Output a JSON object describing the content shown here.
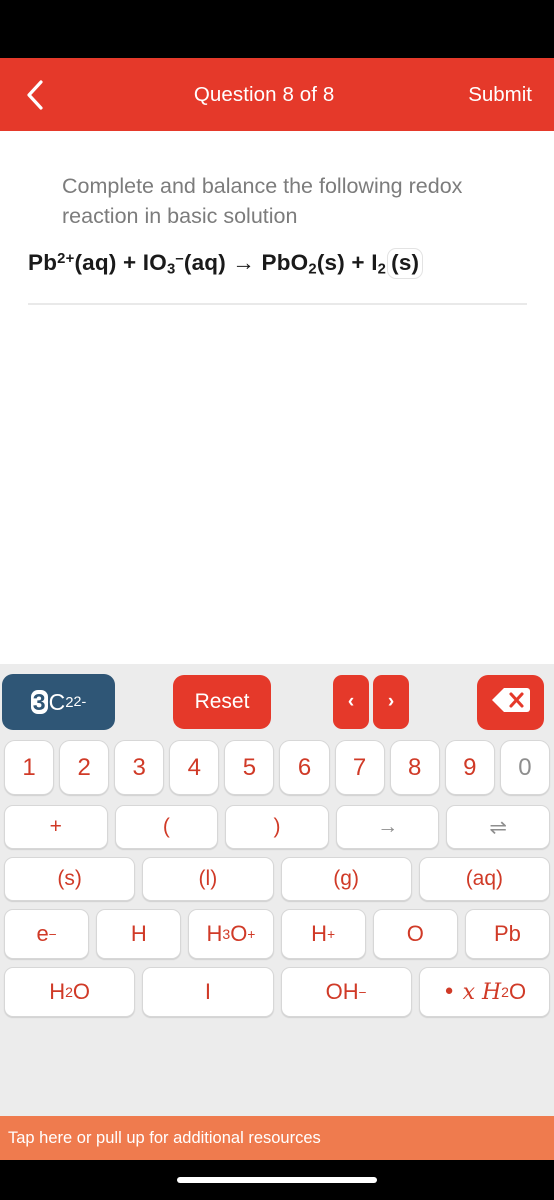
{
  "header": {
    "back_icon": "chevron-left-icon",
    "title": "Question 8 of 8",
    "submit_label": "Submit",
    "background_color": "#e5392a"
  },
  "question": {
    "prompt": "Complete and balance the following redox reaction in basic solution",
    "equation": {
      "parts": [
        {
          "text": "Pb",
          "type": "base"
        },
        {
          "text": "2+",
          "type": "sup"
        },
        {
          "text": "(aq) + IO",
          "type": "base"
        },
        {
          "text": "3",
          "type": "sub"
        },
        {
          "text": "−",
          "type": "sup"
        },
        {
          "text": "(aq) → PbO",
          "type": "base"
        },
        {
          "text": "2",
          "type": "sub"
        },
        {
          "text": "(s) + I",
          "type": "base"
        },
        {
          "text": "2",
          "type": "sub"
        },
        {
          "text": "(s)",
          "type": "cursor"
        }
      ],
      "plain": "Pb2+(aq) + IO3−(aq) → PbO2(s) + I2(s)",
      "cursor_token": "(s)"
    }
  },
  "keypad": {
    "token_chip": {
      "coefficient": "3",
      "symbol": "C",
      "subscript": "2",
      "superscript": "2-",
      "background_color": "#2f5676"
    },
    "reset_label": "Reset",
    "prev_label": "‹",
    "next_label": "›",
    "delete_icon": "backspace-icon",
    "digits": [
      {
        "label": "1",
        "disabled": false
      },
      {
        "label": "2",
        "disabled": false
      },
      {
        "label": "3",
        "disabled": false
      },
      {
        "label": "4",
        "disabled": false
      },
      {
        "label": "5",
        "disabled": false
      },
      {
        "label": "6",
        "disabled": false
      },
      {
        "label": "7",
        "disabled": false
      },
      {
        "label": "8",
        "disabled": false
      },
      {
        "label": "9",
        "disabled": false
      },
      {
        "label": "0",
        "disabled": true
      }
    ],
    "operators": [
      {
        "label": "+",
        "disabled": false
      },
      {
        "label": "(",
        "disabled": false
      },
      {
        "label": ")",
        "disabled": false
      },
      {
        "label": "→",
        "disabled": true
      },
      {
        "label": "⇌",
        "disabled": true
      }
    ],
    "states": [
      {
        "label": "(s)"
      },
      {
        "label": "(l)"
      },
      {
        "label": "(g)"
      },
      {
        "label": "(aq)"
      }
    ],
    "species_row1": [
      {
        "base": "e",
        "sup": "−",
        "sub": ""
      },
      {
        "base": "H",
        "sup": "",
        "sub": ""
      },
      {
        "base": "H",
        "sub": "3",
        "base2": "O",
        "sup": "+"
      },
      {
        "base": "H",
        "sup": "+",
        "sub": ""
      },
      {
        "base": "O",
        "sup": "",
        "sub": ""
      },
      {
        "base": "Pb",
        "sup": "",
        "sub": ""
      }
    ],
    "species_row2": [
      {
        "base": "H",
        "sub": "2",
        "base2": "O"
      },
      {
        "base": "I"
      },
      {
        "base": "OH",
        "sup": "−"
      },
      {
        "base": "• 𝑥 H",
        "sub": "2",
        "base2": "O"
      }
    ],
    "key_text_color": "#d03a27",
    "key_disabled_color": "#8e8e8e",
    "background_color": "#ececec"
  },
  "banner": {
    "text": "Tap here or pull up for additional resources",
    "background_color": "#ef7b4e"
  }
}
